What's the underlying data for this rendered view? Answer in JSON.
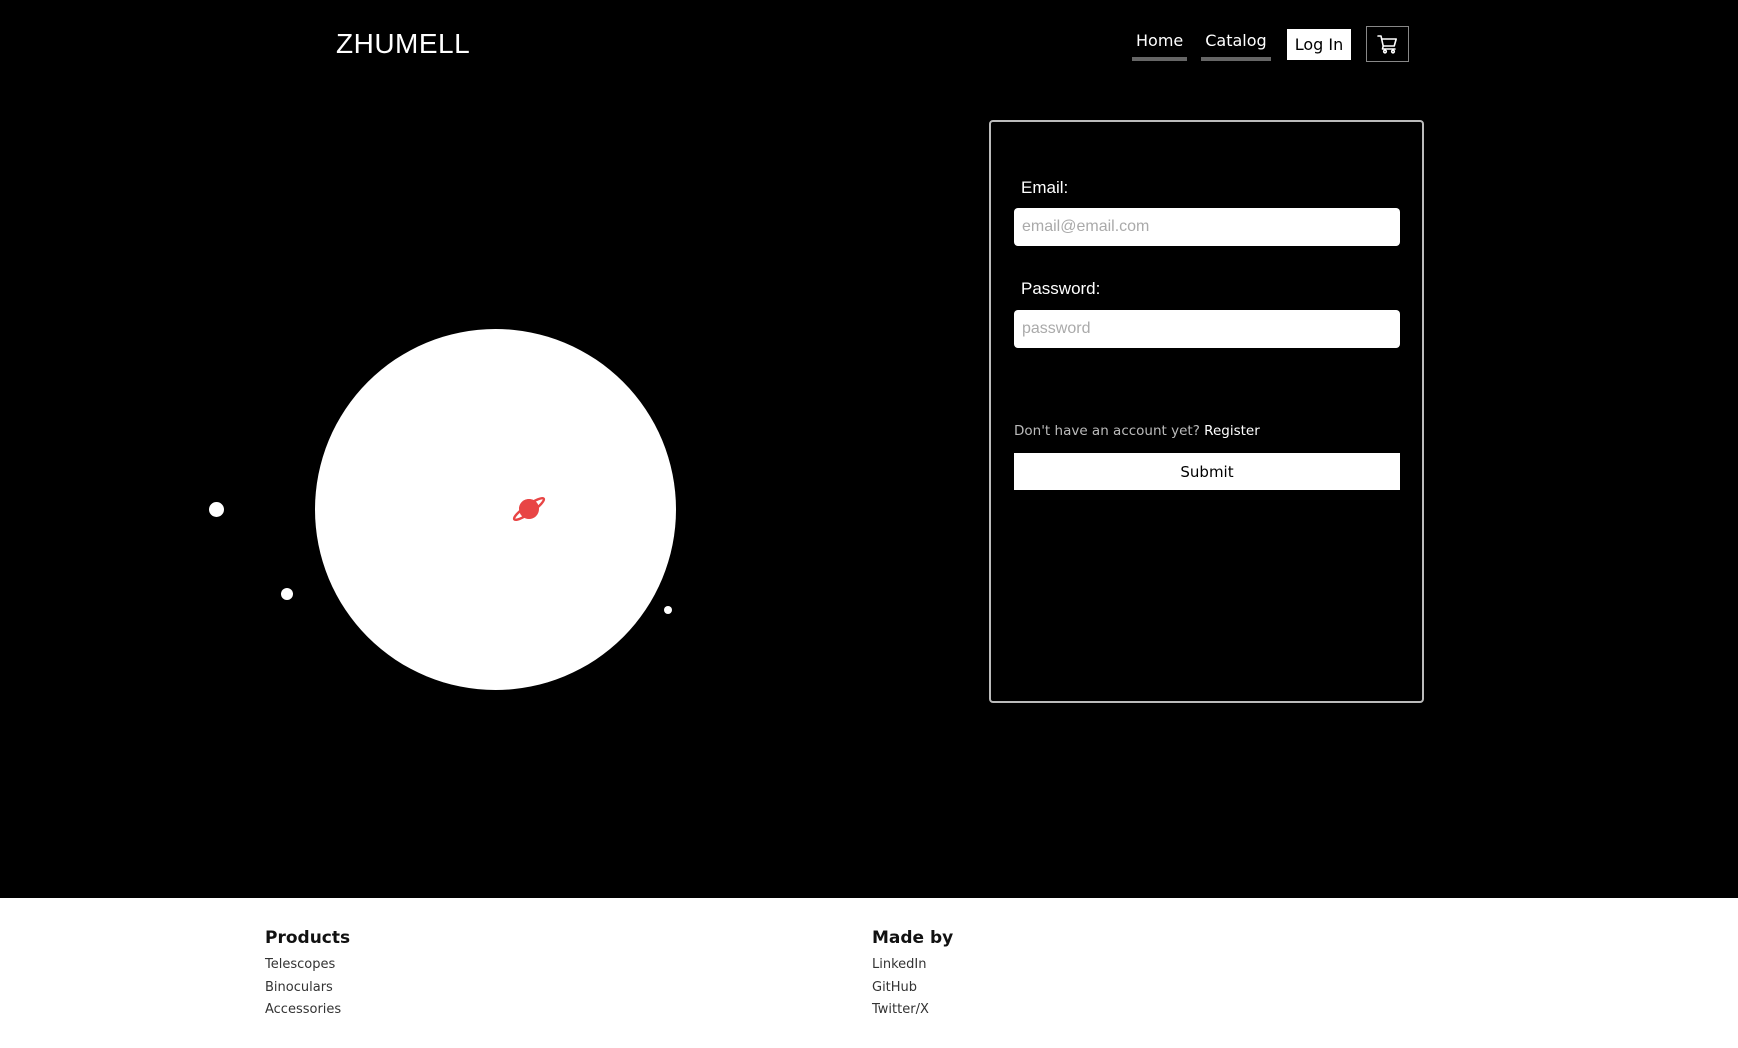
{
  "header": {
    "logo": "ZHUMELL",
    "nav": {
      "home": "Home",
      "catalog": "Catalog",
      "login": "Log In"
    },
    "cart_icon": "cart-icon"
  },
  "hero": {
    "planet_icon": "planet-icon",
    "planet_color": "#e84545"
  },
  "login_form": {
    "email_label": "Email:",
    "email_placeholder": "email@email.com",
    "email_value": "",
    "password_label": "Password:",
    "password_placeholder": "password",
    "password_value": "",
    "register_prompt": "Don't have an account yet?",
    "register_link": "Register",
    "submit_label": "Submit"
  },
  "footer": {
    "products": {
      "heading": "Products",
      "links": [
        "Telescopes",
        "Binoculars",
        "Accessories"
      ]
    },
    "made_by": {
      "heading": "Made by",
      "links": [
        "LinkedIn",
        "GitHub",
        "Twitter/X"
      ]
    }
  }
}
